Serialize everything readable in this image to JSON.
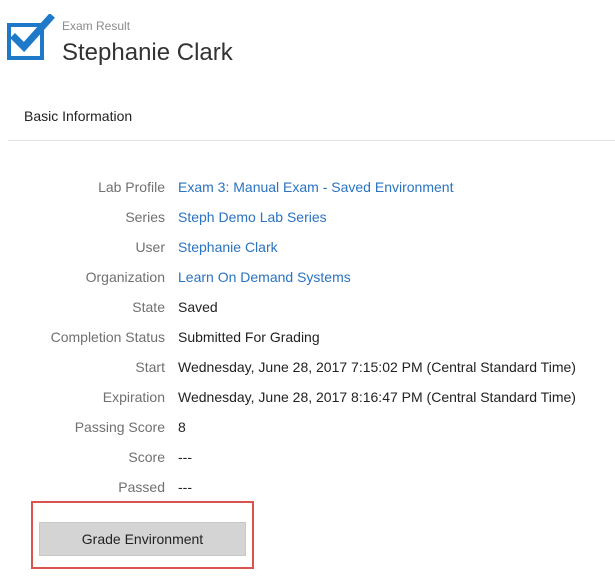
{
  "header": {
    "subtitle": "Exam Result",
    "title": "Stephanie Clark",
    "icon": "checkbox-checked-icon",
    "accent_color": "#1e7ac9"
  },
  "section": {
    "heading": "Basic Information"
  },
  "details": [
    {
      "label": "Lab Profile",
      "value": "Exam 3: Manual Exam - Saved Environment",
      "link": true
    },
    {
      "label": "Series",
      "value": "Steph Demo Lab Series",
      "link": true
    },
    {
      "label": "User",
      "value": "Stephanie Clark",
      "link": true
    },
    {
      "label": "Organization",
      "value": "Learn On Demand Systems",
      "link": true
    },
    {
      "label": "State",
      "value": "Saved",
      "link": false
    },
    {
      "label": "Completion Status",
      "value": "Submitted For Grading",
      "link": false
    },
    {
      "label": "Start",
      "value": "Wednesday, June 28, 2017 7:15:02 PM (Central Standard Time)",
      "link": false
    },
    {
      "label": "Expiration",
      "value": "Wednesday, June 28, 2017 8:16:47 PM (Central Standard Time)",
      "link": false
    },
    {
      "label": "Passing Score",
      "value": "8",
      "link": false
    },
    {
      "label": "Score",
      "value": "---",
      "link": false
    },
    {
      "label": "Passed",
      "value": "---",
      "link": false
    }
  ],
  "actions": {
    "grade_label": "Grade Environment",
    "highlight_color": "#d9534f"
  },
  "colors": {
    "link": "#2a73c2",
    "label": "#707070"
  }
}
